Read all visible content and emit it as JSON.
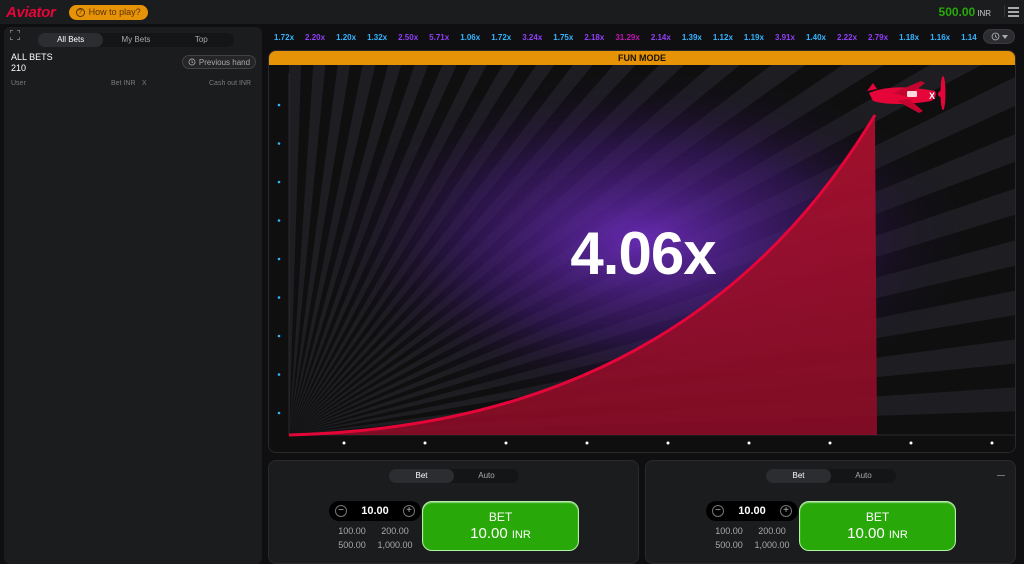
{
  "header": {
    "logo": "Aviator",
    "how_to_play": "How to play?",
    "balance": "500.00",
    "currency": "INR"
  },
  "left": {
    "tabs": [
      "All Bets",
      "My Bets",
      "Top"
    ],
    "active_tab": "All Bets",
    "title": "ALL BETS",
    "count": "210",
    "previous_hand": "Previous hand",
    "columns": {
      "user": "User",
      "bet": "Bet INR",
      "x": "X",
      "cashout": "Cash out INR"
    }
  },
  "history": [
    {
      "v": "1.72x",
      "c": "blue"
    },
    {
      "v": "2.20x",
      "c": "purple"
    },
    {
      "v": "1.20x",
      "c": "blue"
    },
    {
      "v": "1.32x",
      "c": "blue"
    },
    {
      "v": "2.50x",
      "c": "purple"
    },
    {
      "v": "5.71x",
      "c": "purple"
    },
    {
      "v": "1.06x",
      "c": "blue"
    },
    {
      "v": "1.72x",
      "c": "blue"
    },
    {
      "v": "3.24x",
      "c": "purple"
    },
    {
      "v": "1.75x",
      "c": "blue"
    },
    {
      "v": "2.18x",
      "c": "purple"
    },
    {
      "v": "31.29x",
      "c": "pink"
    },
    {
      "v": "2.14x",
      "c": "purple"
    },
    {
      "v": "1.39x",
      "c": "blue"
    },
    {
      "v": "1.12x",
      "c": "blue"
    },
    {
      "v": "1.19x",
      "c": "blue"
    },
    {
      "v": "3.91x",
      "c": "purple"
    },
    {
      "v": "1.40x",
      "c": "blue"
    },
    {
      "v": "2.22x",
      "c": "purple"
    },
    {
      "v": "2.79x",
      "c": "purple"
    },
    {
      "v": "1.18x",
      "c": "blue"
    },
    {
      "v": "1.16x",
      "c": "blue"
    },
    {
      "v": "1.14",
      "c": "blue"
    }
  ],
  "game": {
    "mode_banner": "FUN MODE",
    "multiplier": "4.06x"
  },
  "bet_panels": [
    {
      "tabs": [
        "Bet",
        "Auto"
      ],
      "stake": "10.00",
      "quick": [
        "100.00",
        "200.00",
        "500.00",
        "1,000.00"
      ],
      "button_label": "BET",
      "button_amount": "10.00",
      "button_currency": "INR"
    },
    {
      "tabs": [
        "Bet",
        "Auto"
      ],
      "stake": "10.00",
      "quick": [
        "100.00",
        "200.00",
        "500.00",
        "1,000.00"
      ],
      "button_label": "BET",
      "button_amount": "10.00",
      "button_currency": "INR"
    }
  ],
  "colors": {
    "brand_red": "#e50539",
    "accent_orange": "#e69308",
    "balance_green": "#28a909",
    "history_blue": "#34b4ff",
    "history_purple": "#913ef8",
    "history_pink": "#c017b4"
  }
}
